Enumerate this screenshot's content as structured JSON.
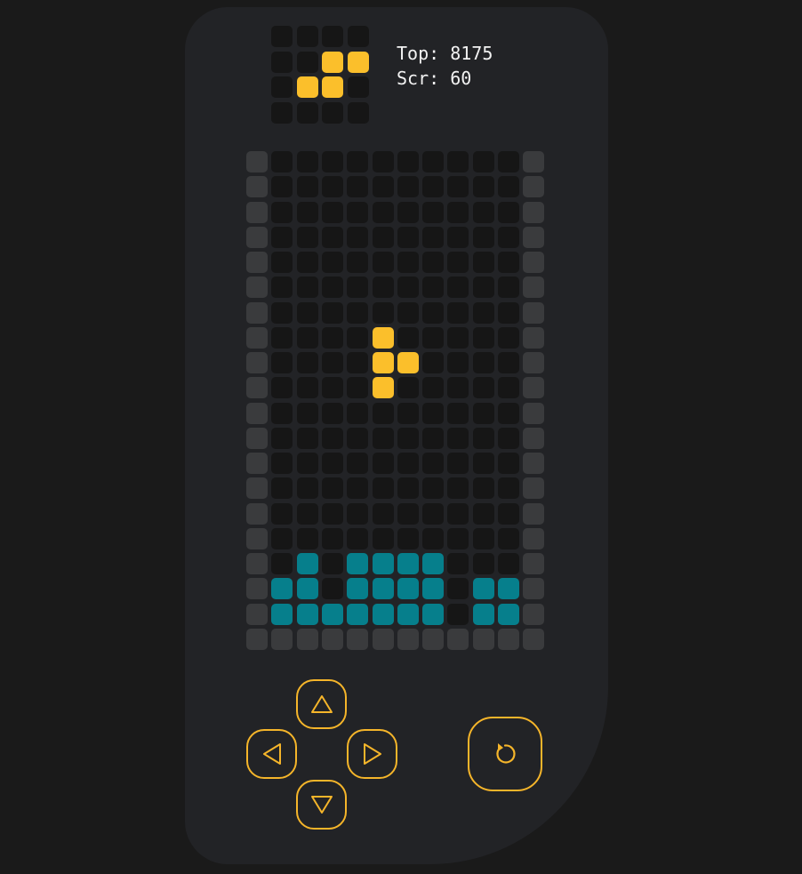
{
  "app": {
    "colors": {
      "background": "#1a1a1a",
      "device": "#222326",
      "empty_cell": "#161616",
      "wall_cell": "#3a3b3d",
      "locked_cell": "#067f8c",
      "active_cell": "#fbbf2b",
      "button_outline": "#f5b52a",
      "text": "#f2f2f2"
    }
  },
  "stats": {
    "top_label": "Top:",
    "top_value": "8175",
    "score_label": "Scr:",
    "score_value": "60"
  },
  "next_piece": {
    "grid": [
      "....",
      "..##",
      ".##.",
      "...."
    ]
  },
  "board": {
    "rows": [
      "W..........W",
      "W..........W",
      "W..........W",
      "W..........W",
      "W..........W",
      "W..........W",
      "W..........W",
      "W....A.....W",
      "W....AA....W",
      "W....A.....W",
      "W..........W",
      "W..........W",
      "W..........W",
      "W..........W",
      "W..........W",
      "W..........W",
      "W.#.####...W",
      "W##.####.##W",
      "W#######.##W",
      "WWWWWWWWWWWW"
    ]
  },
  "controls": {
    "up": {
      "icon": "triangle-up-icon"
    },
    "left": {
      "icon": "triangle-left-icon"
    },
    "right": {
      "icon": "triangle-right-icon"
    },
    "down": {
      "icon": "triangle-down-icon"
    },
    "restart": {
      "icon": "restart-icon",
      "glyph": "↺"
    }
  }
}
